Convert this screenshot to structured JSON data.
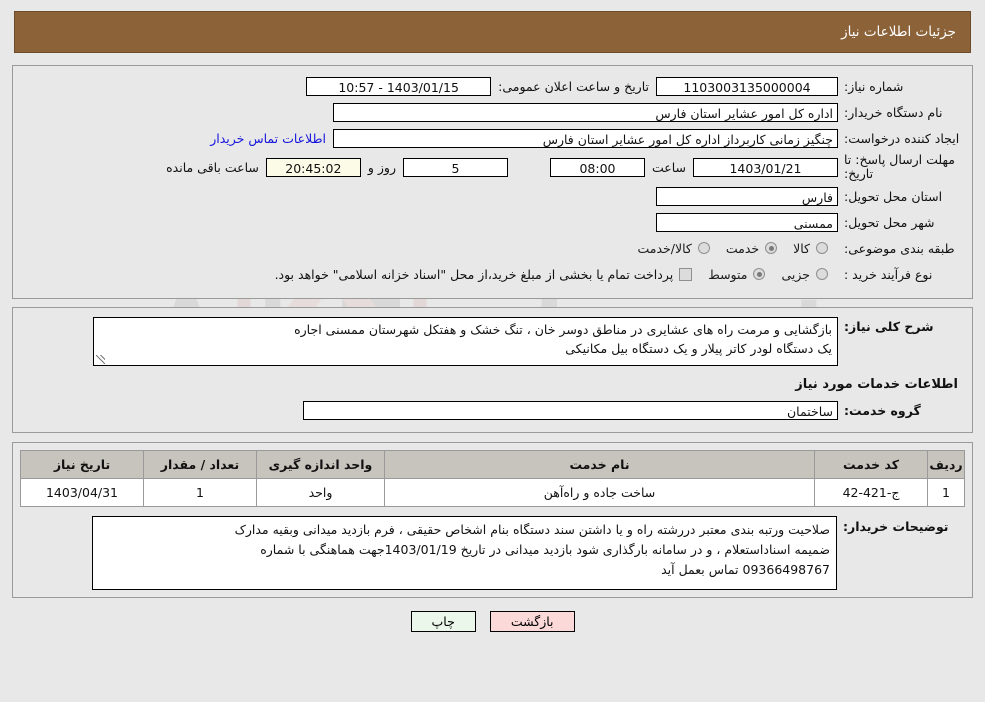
{
  "window": {
    "title": "جزئیات اطلاعات نیاز"
  },
  "fields": {
    "need_number_label": "شماره نیاز:",
    "need_number_value": "1103003135000004",
    "public_announce_label": "تاریخ و ساعت اعلان عمومی:",
    "public_announce_value": "1403/01/15 - 10:57",
    "buyer_org_label": "نام دستگاه خریدار:",
    "buyer_org_value": "اداره کل امور عشایر استان فارس",
    "requester_label": "ایجاد کننده درخواست:",
    "requester_value": "چنگیز زمانی کاربرداز اداره کل امور عشایر استان فارس",
    "buyer_contact_link": "اطلاعات تماس خریدار",
    "deadline_label": "مهلت ارسال پاسخ: تا تاریخ:",
    "deadline_date": "1403/01/21",
    "hour_label": "ساعت",
    "deadline_time": "08:00",
    "days_value": "5",
    "days_label": "روز و",
    "remaining_time": "20:45:02",
    "remaining_label": "ساعت باقی مانده",
    "province_label": "استان محل تحویل:",
    "province_value": "فارس",
    "city_label": "شهر محل تحویل:",
    "city_value": "ممسنی",
    "category_label": "طبقه بندی موضوعی:",
    "process_type_label": "نوع فرآیند خرید :",
    "treasury_note": "پرداخت تمام یا بخشی از مبلغ خرید،از محل \"اسناد خزانه اسلامی\" خواهد بود."
  },
  "category_options": [
    {
      "label": "کالا",
      "selected": false
    },
    {
      "label": "خدمت",
      "selected": true
    },
    {
      "label": "کالا/خدمت",
      "selected": false
    }
  ],
  "process_options": [
    {
      "label": "جزیی",
      "selected": false
    },
    {
      "label": "متوسط",
      "selected": true
    }
  ],
  "treasury_checkbox_checked": false,
  "description": {
    "label": "شرح کلی نیاز:",
    "line1": "بازگشایی و مرمت راه های  عشایری در مناطق دوسر خان ، تنگ خشک و هفتکل  شهرستان ممسنی اجاره",
    "line2": "یک دستگاه لودر کاتر پیلار و یک دستگاه بیل مکانیکی"
  },
  "services_section": {
    "heading": "اطلاعات خدمات مورد نیاز",
    "group_label": "گروه خدمت:",
    "group_value": "ساختمان"
  },
  "table": {
    "headers": [
      "ردیف",
      "کد خدمت",
      "نام خدمت",
      "واحد اندازه گیری",
      "تعداد / مقدار",
      "تاریخ نیاز"
    ],
    "rows": [
      [
        "1",
        "ج-421-42",
        "ساخت جاده و راه‌آهن",
        "واحد",
        "1",
        "1403/04/31"
      ]
    ]
  },
  "buyer_notes": {
    "label": "توضیحات خریدار:",
    "line1": "صلاحیت ورتبه بندی معتبر دررشته راه و یا داشتن سند دستگاه  بنام اشخاص حقیقی ، فرم بازدید میدانی  وبقیه مدارک",
    "line2": "ضمیمه اسناداستعلام ، و در سامانه بارگذاری شود بازدید میدانی در تاریخ 1403/01/19جهت هماهنگی با شماره",
    "line3": "09366498767 تماس بعمل آید"
  },
  "buttons": {
    "print": "چاپ",
    "back": "بازگشت"
  },
  "watermark": {
    "text": "AriaTender.net"
  },
  "colors": {
    "titlebar_bg": "#8c6239",
    "link": "#1414dc",
    "print_btn": "#eaf7ea",
    "back_btn": "#fbd9d9",
    "header_row": "#c7c4bd"
  }
}
